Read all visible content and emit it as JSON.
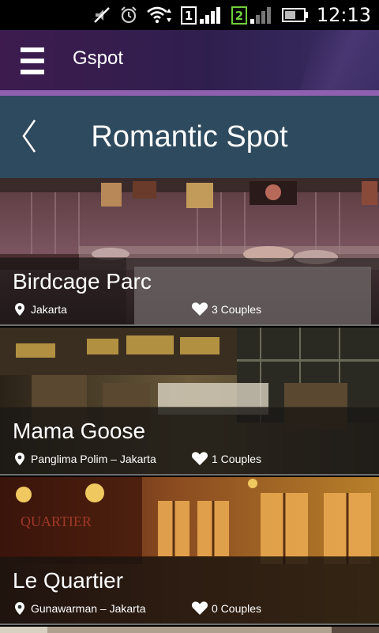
{
  "status_bar": {
    "time": "12:13",
    "icons": [
      "mute-icon",
      "alarm-icon",
      "wifi-icon",
      "sim1-signal-icon",
      "sim2-signal-icon",
      "battery-icon"
    ],
    "sim1_label": "1",
    "sim2_label": "2"
  },
  "app_bar": {
    "title": "Gspot",
    "menu_icon": "hamburger-menu-icon"
  },
  "section": {
    "title": "Romantic Spot",
    "back_icon": "chevron-left-icon"
  },
  "spots": [
    {
      "name": "Birdcage Parc",
      "location": "Jakarta",
      "likes": "3 Couples"
    },
    {
      "name": "Mama Goose",
      "location": "Panglima Polim – Jakarta",
      "likes": "1 Couples"
    },
    {
      "name": "Le Quartier",
      "location": "Gunawarman – Jakarta",
      "likes": "0 Couples"
    }
  ],
  "colors": {
    "app_bar": "#3d1b4e",
    "accent_underline": "#8f5fb0",
    "section_header": "#2e4a5e"
  }
}
